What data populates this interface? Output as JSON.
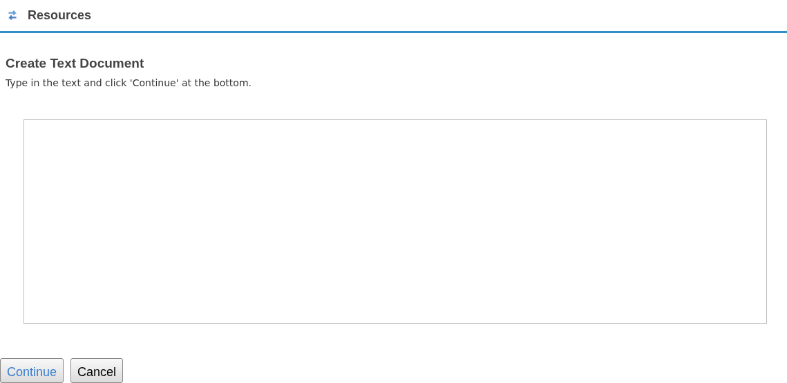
{
  "header": {
    "title": "Resources"
  },
  "form": {
    "title": "Create Text Document",
    "instructions": "Type in the text and click 'Continue' at the bottom."
  },
  "buttons": [
    {
      "label": "Continue",
      "kind": "primary"
    },
    {
      "label": "Cancel",
      "kind": "secondary"
    }
  ]
}
